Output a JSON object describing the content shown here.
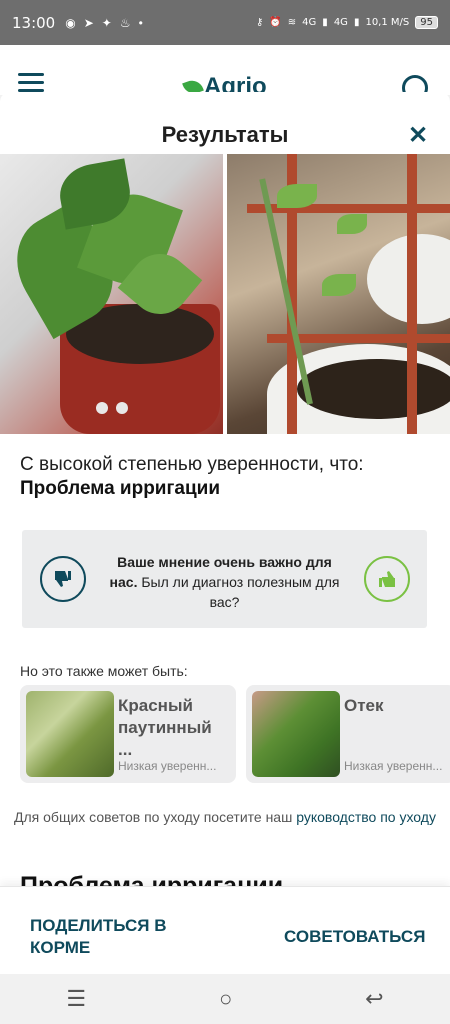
{
  "status_bar": {
    "time": "13:00",
    "left_icons": [
      "telegram-icon",
      "telegram-icon",
      "sparkle-icon",
      "flame-icon",
      "dot-icon"
    ],
    "network_1": "4G",
    "network_2": "4G",
    "speed": "10,1",
    "speed_unit": "M/S",
    "battery": "95"
  },
  "app_header": {
    "logo_text": "Agrio"
  },
  "sheet": {
    "title": "Результаты",
    "confidence_text": "С высокой степенью уверенности, что:",
    "diagnosis": "Проблема ирригации",
    "feedback": {
      "bold": "Ваше мнение очень важно для нас.",
      "rest": " Был ли диагноз полезным для вас?"
    },
    "alternatives_label": "Но это также может быть:",
    "alternatives": [
      {
        "name": "Красный паутинный ...",
        "confidence": "Низкая уверенн..."
      },
      {
        "name": "Отек",
        "confidence": "Низкая уверенн..."
      }
    ],
    "guide_text": "Для общих советов по уходу посетите наш ",
    "guide_link": "руководство по уходу",
    "section_title": "Проблема ирригации"
  },
  "actions": {
    "share": "ПОДЕЛИТЬСЯ В КОРМЕ",
    "consult": "СОВЕТОВАТЬСЯ"
  },
  "colors": {
    "primary": "#0f4a5c",
    "accent": "#7ac143"
  }
}
